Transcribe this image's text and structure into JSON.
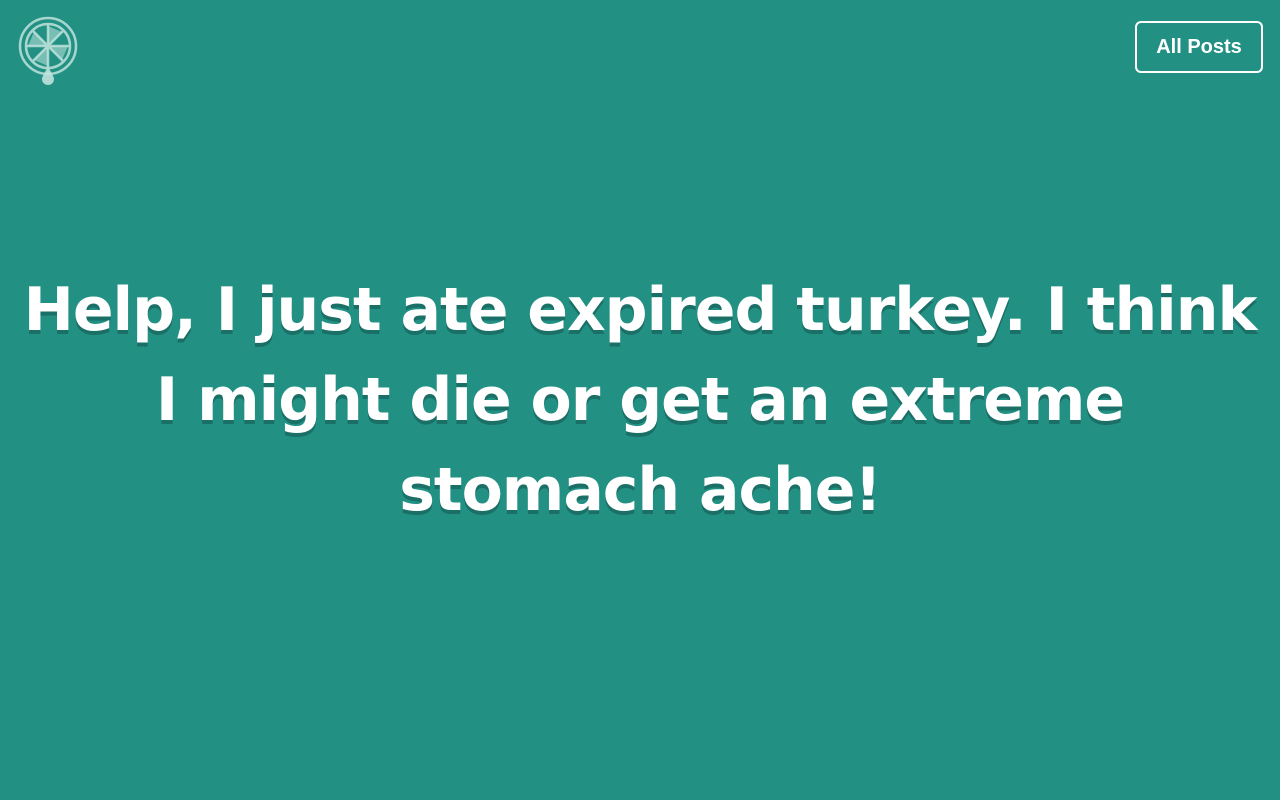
{
  "logo": {
    "icon": "lime-slice-icon",
    "color": "#bfe3dd"
  },
  "nav": {
    "all_posts_label": "All Posts"
  },
  "post": {
    "title": "Help, I just ate expired turkey. I think I might die or get an extreme stomach ache!"
  },
  "theme": {
    "background": "#229184",
    "text": "#ffffff"
  }
}
